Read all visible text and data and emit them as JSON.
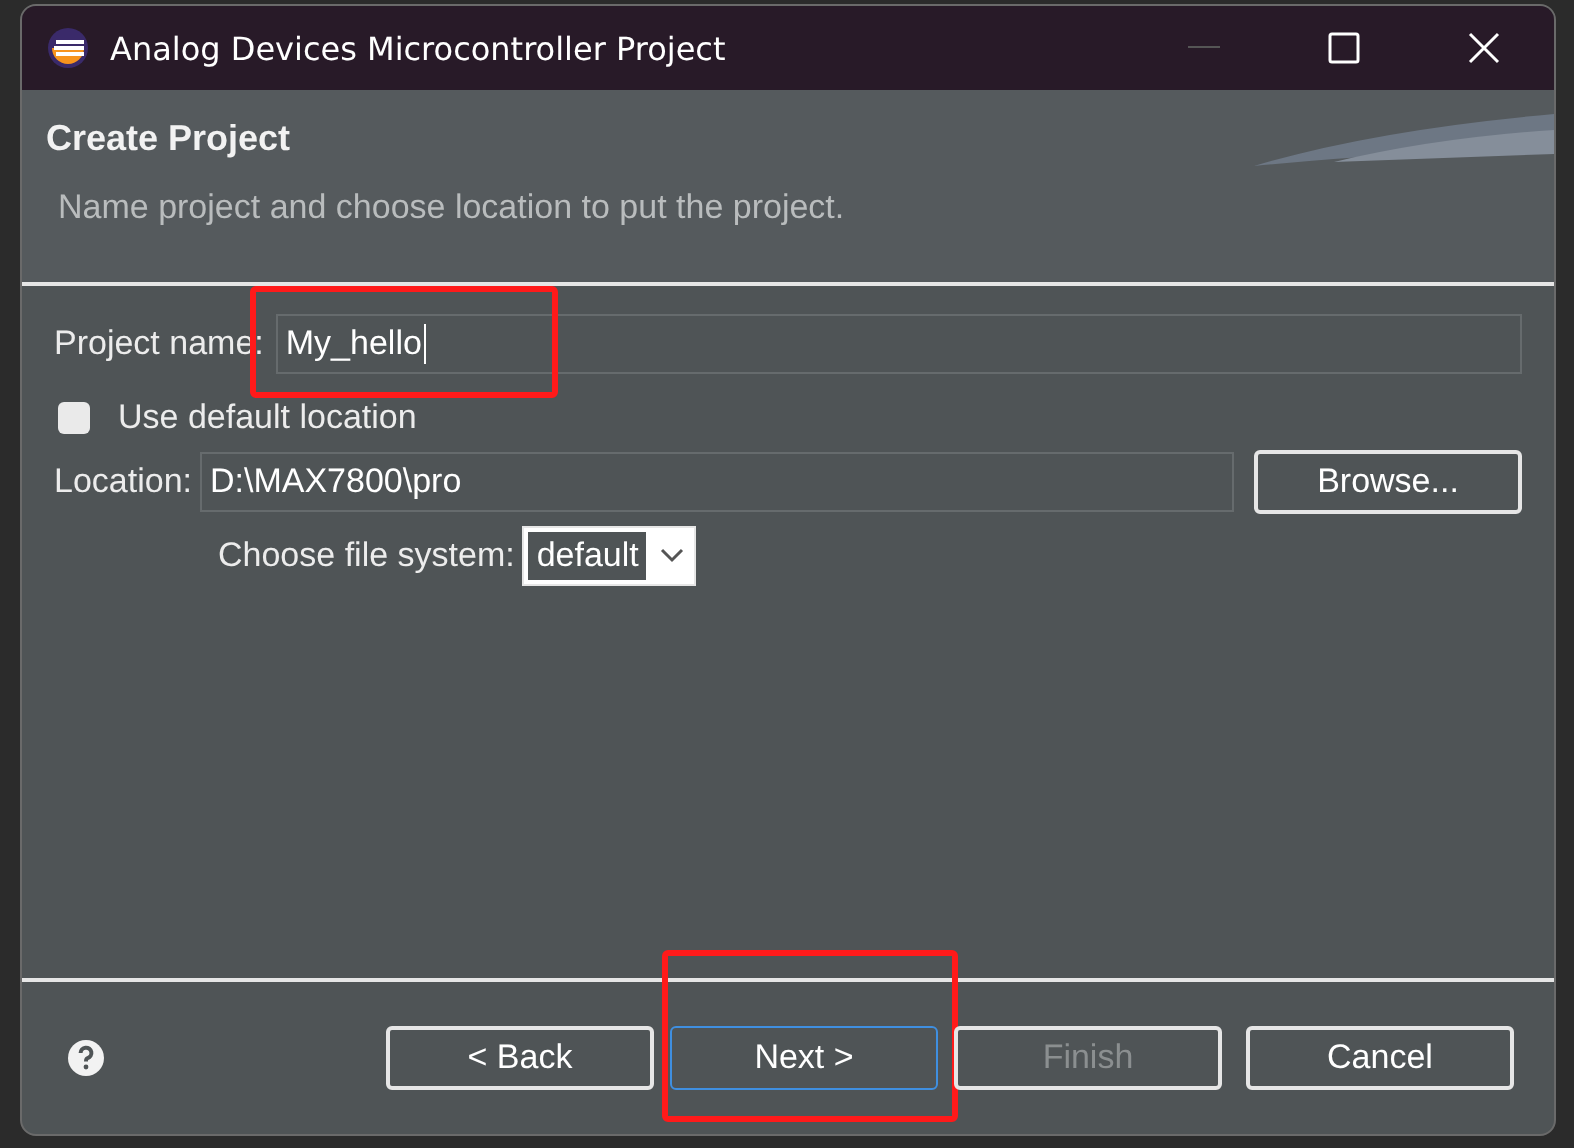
{
  "window": {
    "title": "Analog Devices Microcontroller Project"
  },
  "header": {
    "title": "Create Project",
    "description": "Name project and choose location to put the project."
  },
  "project_name": {
    "label": "Project name:",
    "value": "My_hello",
    "highlighted": true
  },
  "use_default_location": {
    "label": "Use default location",
    "checked": false
  },
  "location": {
    "label": "Location:",
    "value": "D:\\MAX7800\\pro"
  },
  "browse_button": {
    "label": "Browse..."
  },
  "file_system": {
    "label": "Choose file system:",
    "value": "default"
  },
  "buttons": [
    {
      "label": "< Back",
      "disabled": false,
      "focused": false,
      "highlighted": false
    },
    {
      "label": "Next >",
      "disabled": false,
      "focused": true,
      "highlighted": true
    },
    {
      "label": "Finish",
      "disabled": true,
      "focused": false,
      "highlighted": false
    },
    {
      "label": "Cancel",
      "disabled": false,
      "focused": false,
      "highlighted": false
    }
  ]
}
